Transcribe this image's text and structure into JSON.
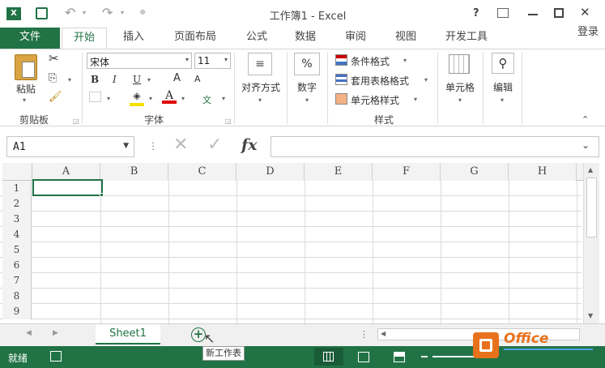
{
  "window": {
    "title": "工作簿1 - Excel",
    "help": "?",
    "restore_ribbon": "⌅",
    "minimize": "—",
    "maximize": "☐",
    "close": "✕"
  },
  "tabs": [
    {
      "label": "文件"
    },
    {
      "label": "开始"
    },
    {
      "label": "插入"
    },
    {
      "label": "页面布局"
    },
    {
      "label": "公式"
    },
    {
      "label": "数据"
    },
    {
      "label": "审阅"
    },
    {
      "label": "视图"
    },
    {
      "label": "开发工具"
    }
  ],
  "signin": "登录",
  "ribbon": {
    "clipboard": {
      "paste": "粘贴",
      "group": "剪贴板"
    },
    "font": {
      "name": "宋体",
      "size": "11",
      "bold": "B",
      "italic": "I",
      "underline": "U",
      "grow": "A",
      "shrink": "A",
      "group": "字体",
      "phonetic": "文"
    },
    "alignment": {
      "label": "对齐方式"
    },
    "number": {
      "label": "数字",
      "symbol": "%"
    },
    "styles": {
      "conditional": "条件格式",
      "table": "套用表格格式",
      "cell": "单元格样式",
      "group": "样式"
    },
    "cells": {
      "label": "单元格"
    },
    "editing": {
      "label": "编辑"
    }
  },
  "formula_bar": {
    "name_box": "A1",
    "fx": "fx",
    "value": ""
  },
  "columns": [
    "A",
    "B",
    "C",
    "D",
    "E",
    "F",
    "G",
    "H"
  ],
  "rows": [
    "1",
    "2",
    "3",
    "4",
    "5",
    "6",
    "7",
    "8",
    "9"
  ],
  "sheet": {
    "tab": "Sheet1",
    "new_sheet_tooltip": "新工作表"
  },
  "status": {
    "ready": "就绪"
  },
  "accent": "#217346"
}
